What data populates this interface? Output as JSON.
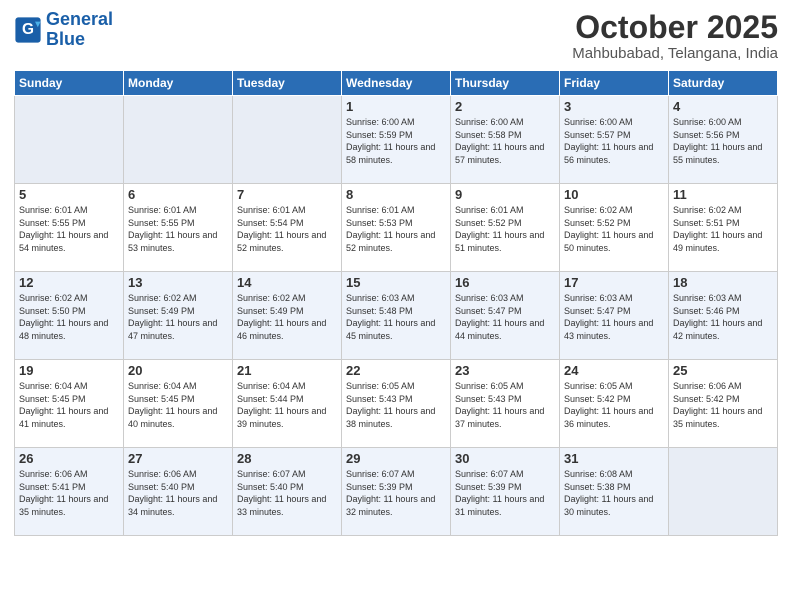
{
  "logo": {
    "line1": "General",
    "line2": "Blue"
  },
  "title": "October 2025",
  "location": "Mahbubabad, Telangana, India",
  "weekdays": [
    "Sunday",
    "Monday",
    "Tuesday",
    "Wednesday",
    "Thursday",
    "Friday",
    "Saturday"
  ],
  "weeks": [
    [
      {
        "day": "",
        "empty": true
      },
      {
        "day": "",
        "empty": true
      },
      {
        "day": "",
        "empty": true
      },
      {
        "day": "1",
        "sunrise": "6:00 AM",
        "sunset": "5:59 PM",
        "daylight": "11 hours and 58 minutes."
      },
      {
        "day": "2",
        "sunrise": "6:00 AM",
        "sunset": "5:58 PM",
        "daylight": "11 hours and 57 minutes."
      },
      {
        "day": "3",
        "sunrise": "6:00 AM",
        "sunset": "5:57 PM",
        "daylight": "11 hours and 56 minutes."
      },
      {
        "day": "4",
        "sunrise": "6:00 AM",
        "sunset": "5:56 PM",
        "daylight": "11 hours and 55 minutes."
      }
    ],
    [
      {
        "day": "5",
        "sunrise": "6:01 AM",
        "sunset": "5:55 PM",
        "daylight": "11 hours and 54 minutes."
      },
      {
        "day": "6",
        "sunrise": "6:01 AM",
        "sunset": "5:55 PM",
        "daylight": "11 hours and 53 minutes."
      },
      {
        "day": "7",
        "sunrise": "6:01 AM",
        "sunset": "5:54 PM",
        "daylight": "11 hours and 52 minutes."
      },
      {
        "day": "8",
        "sunrise": "6:01 AM",
        "sunset": "5:53 PM",
        "daylight": "11 hours and 52 minutes."
      },
      {
        "day": "9",
        "sunrise": "6:01 AM",
        "sunset": "5:52 PM",
        "daylight": "11 hours and 51 minutes."
      },
      {
        "day": "10",
        "sunrise": "6:02 AM",
        "sunset": "5:52 PM",
        "daylight": "11 hours and 50 minutes."
      },
      {
        "day": "11",
        "sunrise": "6:02 AM",
        "sunset": "5:51 PM",
        "daylight": "11 hours and 49 minutes."
      }
    ],
    [
      {
        "day": "12",
        "sunrise": "6:02 AM",
        "sunset": "5:50 PM",
        "daylight": "11 hours and 48 minutes."
      },
      {
        "day": "13",
        "sunrise": "6:02 AM",
        "sunset": "5:49 PM",
        "daylight": "11 hours and 47 minutes."
      },
      {
        "day": "14",
        "sunrise": "6:02 AM",
        "sunset": "5:49 PM",
        "daylight": "11 hours and 46 minutes."
      },
      {
        "day": "15",
        "sunrise": "6:03 AM",
        "sunset": "5:48 PM",
        "daylight": "11 hours and 45 minutes."
      },
      {
        "day": "16",
        "sunrise": "6:03 AM",
        "sunset": "5:47 PM",
        "daylight": "11 hours and 44 minutes."
      },
      {
        "day": "17",
        "sunrise": "6:03 AM",
        "sunset": "5:47 PM",
        "daylight": "11 hours and 43 minutes."
      },
      {
        "day": "18",
        "sunrise": "6:03 AM",
        "sunset": "5:46 PM",
        "daylight": "11 hours and 42 minutes."
      }
    ],
    [
      {
        "day": "19",
        "sunrise": "6:04 AM",
        "sunset": "5:45 PM",
        "daylight": "11 hours and 41 minutes."
      },
      {
        "day": "20",
        "sunrise": "6:04 AM",
        "sunset": "5:45 PM",
        "daylight": "11 hours and 40 minutes."
      },
      {
        "day": "21",
        "sunrise": "6:04 AM",
        "sunset": "5:44 PM",
        "daylight": "11 hours and 39 minutes."
      },
      {
        "day": "22",
        "sunrise": "6:05 AM",
        "sunset": "5:43 PM",
        "daylight": "11 hours and 38 minutes."
      },
      {
        "day": "23",
        "sunrise": "6:05 AM",
        "sunset": "5:43 PM",
        "daylight": "11 hours and 37 minutes."
      },
      {
        "day": "24",
        "sunrise": "6:05 AM",
        "sunset": "5:42 PM",
        "daylight": "11 hours and 36 minutes."
      },
      {
        "day": "25",
        "sunrise": "6:06 AM",
        "sunset": "5:42 PM",
        "daylight": "11 hours and 35 minutes."
      }
    ],
    [
      {
        "day": "26",
        "sunrise": "6:06 AM",
        "sunset": "5:41 PM",
        "daylight": "11 hours and 35 minutes."
      },
      {
        "day": "27",
        "sunrise": "6:06 AM",
        "sunset": "5:40 PM",
        "daylight": "11 hours and 34 minutes."
      },
      {
        "day": "28",
        "sunrise": "6:07 AM",
        "sunset": "5:40 PM",
        "daylight": "11 hours and 33 minutes."
      },
      {
        "day": "29",
        "sunrise": "6:07 AM",
        "sunset": "5:39 PM",
        "daylight": "11 hours and 32 minutes."
      },
      {
        "day": "30",
        "sunrise": "6:07 AM",
        "sunset": "5:39 PM",
        "daylight": "11 hours and 31 minutes."
      },
      {
        "day": "31",
        "sunrise": "6:08 AM",
        "sunset": "5:38 PM",
        "daylight": "11 hours and 30 minutes."
      },
      {
        "day": "",
        "empty": true
      }
    ]
  ]
}
